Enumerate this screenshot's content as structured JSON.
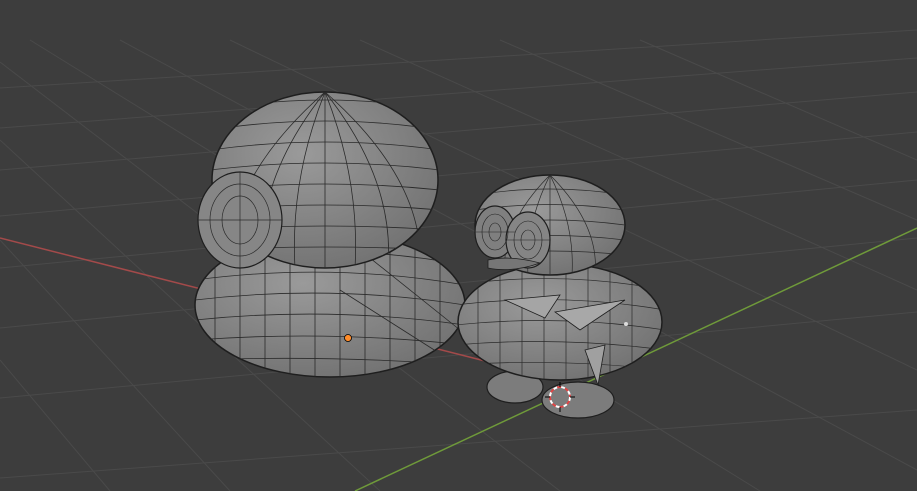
{
  "viewport": {
    "background": "#3d3d3d",
    "grid_color": "#4a4a4a",
    "x_axis_color": "#a34a4a",
    "y_axis_color": "#6f9a3a"
  },
  "objects": [
    {
      "name": "large-mesh-body",
      "color": "#8a8a8a",
      "wire": "#1e1e1e"
    },
    {
      "name": "small-mesh-figure",
      "color": "#8c8c8c",
      "wire": "#1e1e1e"
    }
  ],
  "markers": {
    "origin_color": "#ff8c2a",
    "cursor_colors": [
      "#e04545",
      "#ffffff"
    ]
  }
}
